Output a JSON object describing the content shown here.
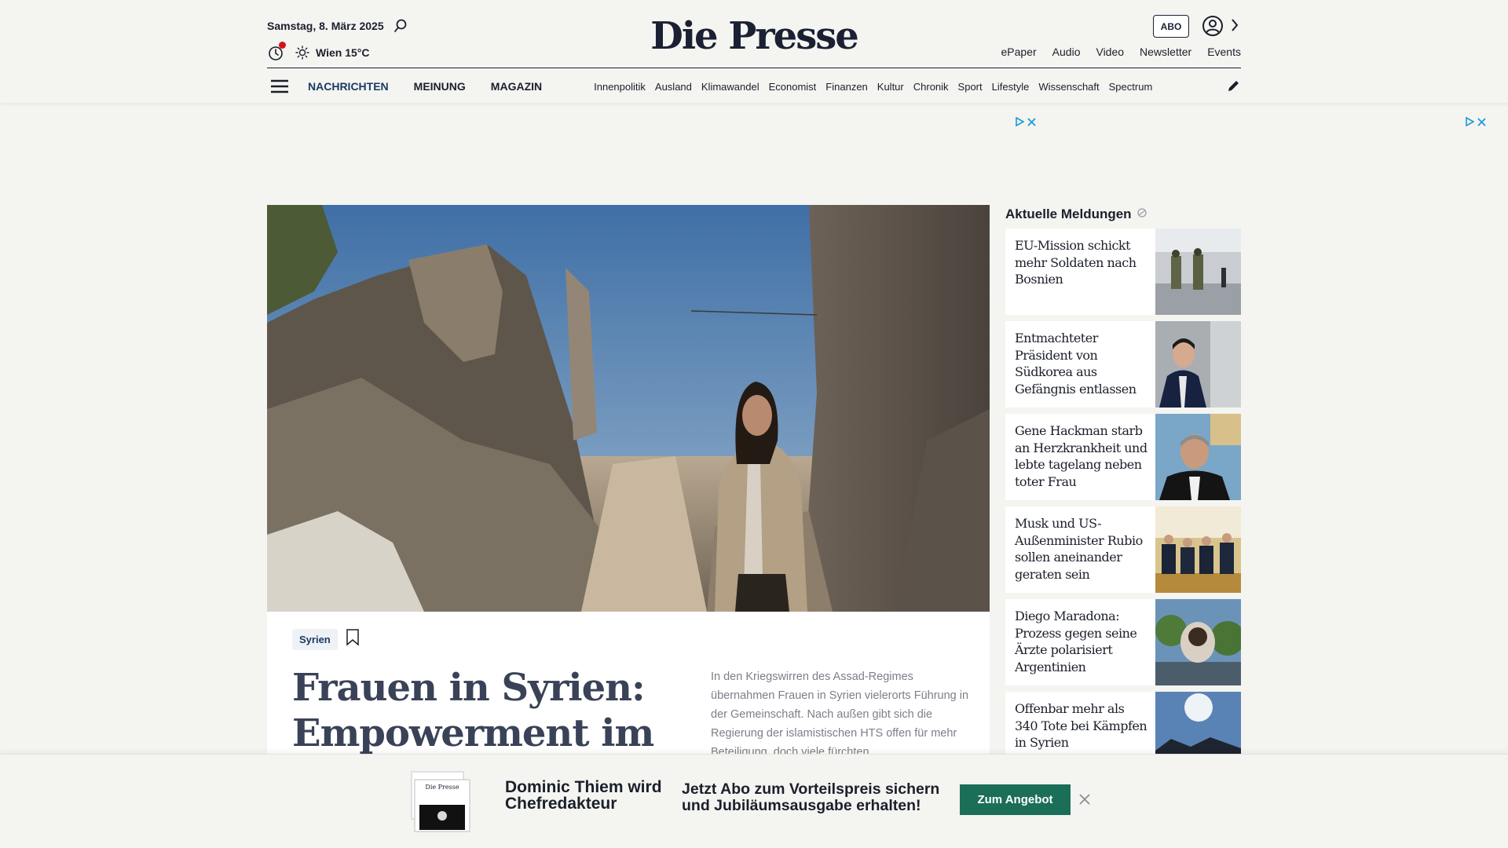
{
  "header": {
    "date": "Samstag, 8. März 2025",
    "weather": "Wien 15°C",
    "logo": "Die Presse",
    "abo_label": "ABO",
    "service_links": [
      "ePaper",
      "Audio",
      "Video",
      "Newsletter",
      "Events"
    ]
  },
  "nav": {
    "main": [
      "NACHRICHTEN",
      "MEINUNG",
      "MAGAZIN"
    ],
    "sub": [
      "Innenpolitik",
      "Ausland",
      "Klimawandel",
      "Economist",
      "Finanzen",
      "Kultur",
      "Chronik",
      "Sport",
      "Lifestyle",
      "Wissenschaft",
      "Spectrum"
    ]
  },
  "article": {
    "tag": "Syrien",
    "headline": "Frauen in Syrien: Empowerment im",
    "teaser": "In den Kriegswirren des Assad-Regimes übernahmen Frauen in Syrien vielerorts Führung in der Gemeinschaft. Nach außen gibt sich die Regierung der islamistischen HTS offen für mehr Beteiligung, doch viele fürchten"
  },
  "sidebar": {
    "title": "Aktuelle Meldungen",
    "items": [
      {
        "title": "EU-Mission schickt mehr Soldaten nach Bosnien"
      },
      {
        "title": "Entmachteter Präsident von Südkorea aus Gefängnis entlassen"
      },
      {
        "title": "Gene Hackman starb an Herzkrankheit und lebte tagelang neben toter Frau"
      },
      {
        "title": "Musk und US-Außenminister Rubio sollen aneinander geraten sein"
      },
      {
        "title": "Diego Maradona: Prozess gegen seine Ärzte polarisiert Argentinien"
      },
      {
        "title": "Offenbar mehr als 340 Tote bei Kämpfen in Syrien"
      }
    ]
  },
  "promo": {
    "title": "Dominic Thiem wird Chefredakteur",
    "text": "Jetzt Abo zum Vorteilspreis sichern und Jubiläumsausgabe erhalten!",
    "button": "Zum Angebot",
    "cover_logo": "Die Presse"
  },
  "colors": {
    "brand_navy": "#1b2033",
    "nav_active": "#1b3a64",
    "promo_button": "#1b6e57",
    "notification": "#d4121c",
    "ad_icon": "#1a9bdb"
  }
}
